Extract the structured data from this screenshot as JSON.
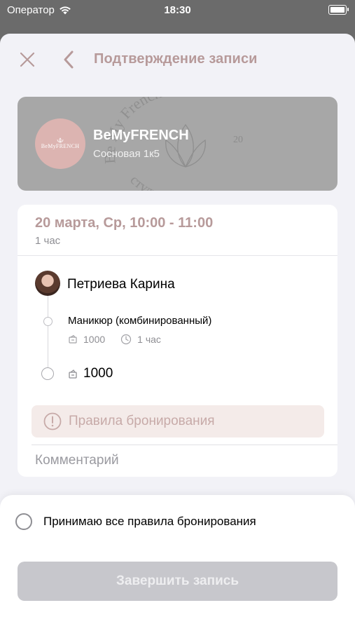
{
  "status_bar": {
    "carrier": "Оператор",
    "time": "18:30"
  },
  "nav": {
    "title": "Подтверждение записи"
  },
  "salon": {
    "name": "BeMyFRENCH",
    "address": "Сосновая 1к5",
    "logo_text": "BeMyFRENCH",
    "watermark_lines": [
      "Be My French",
      "студия маникюра",
      "20"
    ]
  },
  "booking": {
    "date_time": "20 марта, Ср, 10:00 - 11:00",
    "duration": "1 час",
    "master": "Петриева Карина",
    "service_name": "Маникюр (комбинированный)",
    "service_price": "1000",
    "service_duration": "1 час",
    "total": "1000",
    "rules_label": "Правила бронирования",
    "comment_placeholder": "Комментарий"
  },
  "footer": {
    "accept_label": "Принимаю все правила бронирования",
    "submit_label": "Завершить запись"
  },
  "colors": {
    "accent": "#b79a9a",
    "logo_bg": "#dcb4b1",
    "salon_card_bg": "#a7a7a7",
    "button_disabled": "#c7c7cc",
    "rules_bg": "#f4ebe9"
  }
}
